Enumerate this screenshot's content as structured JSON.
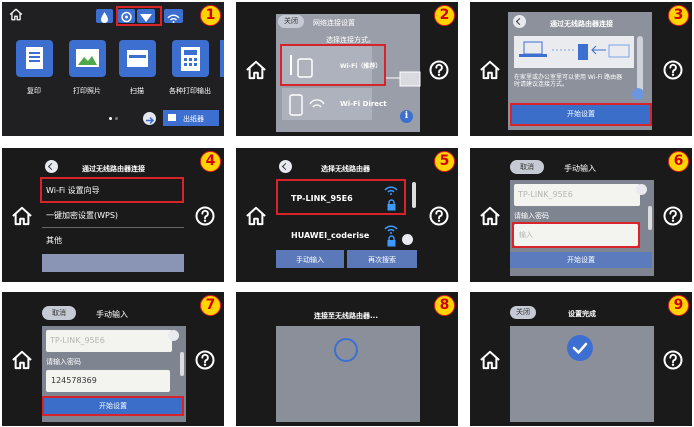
{
  "steps": [
    "1",
    "2",
    "3",
    "4",
    "5",
    "6",
    "7",
    "8",
    "9"
  ],
  "p1": {
    "tiles": [
      "复印",
      "打印照片",
      "扫描",
      "各种打印输出"
    ],
    "exit_label": "出纸器"
  },
  "p2": {
    "back_label": "关闭",
    "title": "网络连接设置",
    "subtitle": "选择连接方式。",
    "opt_wifi": "Wi-Fi（推荐）",
    "opt_direct": "Wi-Fi Direct"
  },
  "p3": {
    "title": "通过无线路由器连接",
    "desc": "在家里或办公室里可以使用 Wi-Fi 路由器时请建议连接方式。",
    "start_label": "开始设置"
  },
  "p4": {
    "title": "通过无线路由器连接",
    "items": [
      "Wi-Fi 设置向导",
      "一键加密设置(WPS)",
      "其他"
    ]
  },
  "p5": {
    "title": "选择无线路由器",
    "networks": [
      "TP-LINK_95E6",
      "HUAWEI_coderise"
    ],
    "manual_label": "手动输入",
    "rescan_label": "再次搜索"
  },
  "p6": {
    "cancel_label": "取消",
    "title": "手动输入",
    "ssid": "TP-LINK_95E6",
    "pw_label": "请输入密码",
    "pw_value": "输入",
    "start_label": "开始设置"
  },
  "p7": {
    "cancel_label": "取消",
    "title": "手动输入",
    "ssid": "TP-LINK_95E6",
    "pw_label": "请输入密码",
    "pw_value": "124578369",
    "start_label": "开始设置"
  },
  "p8": {
    "title": "连接至无线路由器..."
  },
  "p9": {
    "back_label": "关闭",
    "title": "设置完成"
  }
}
